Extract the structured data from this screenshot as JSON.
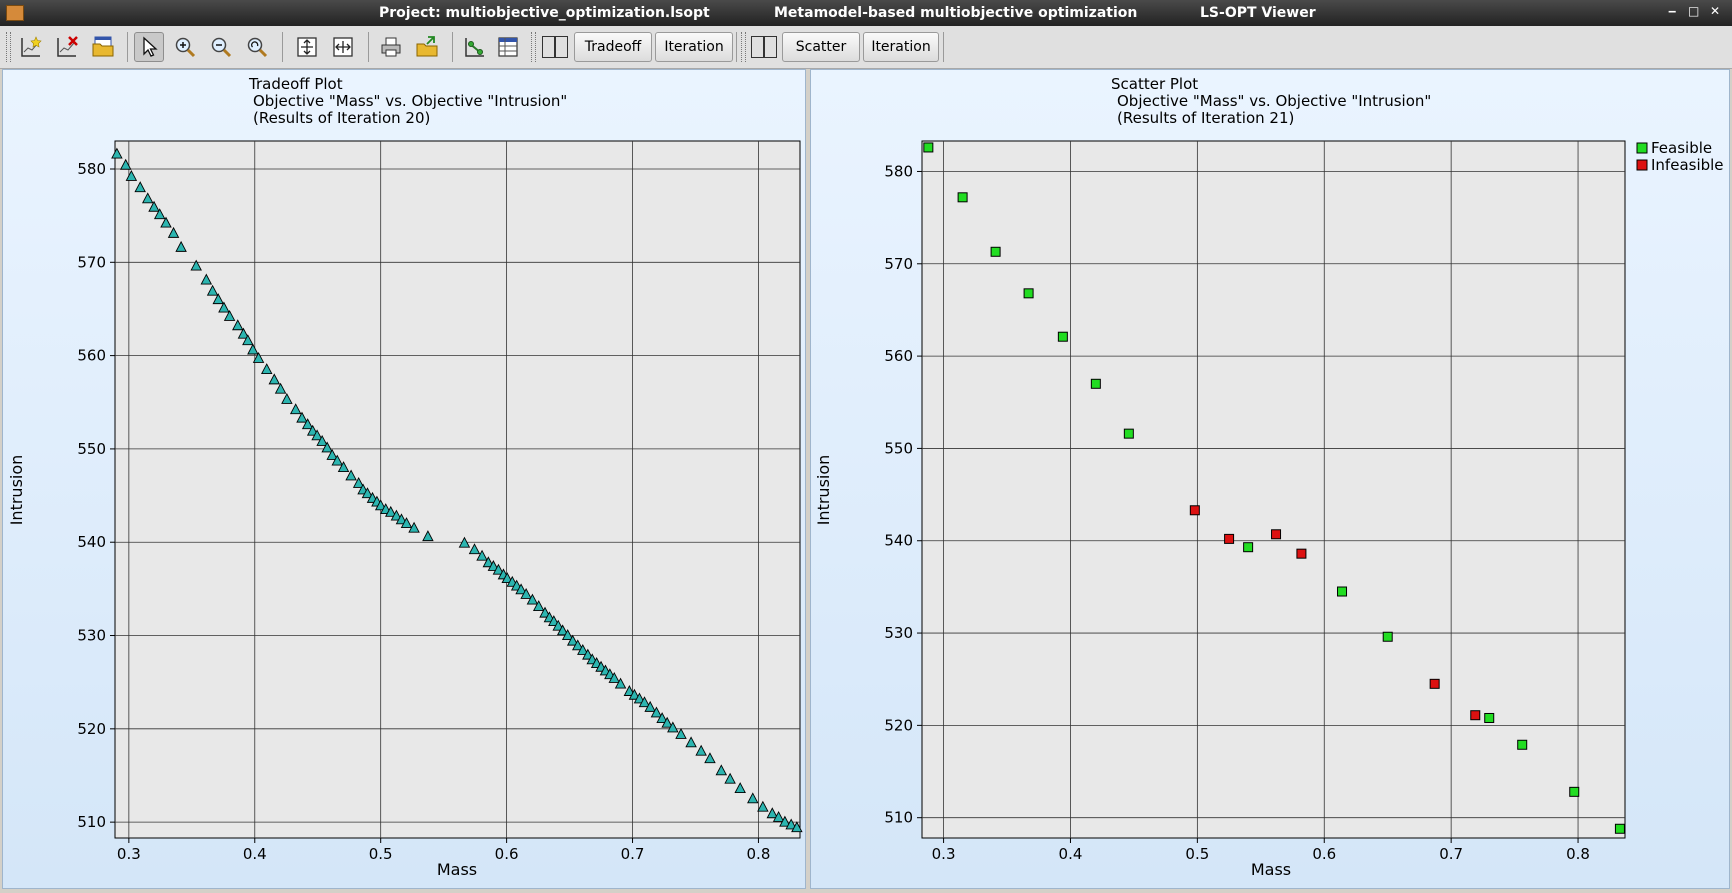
{
  "window": {
    "project_title": "Project: multiobjective_optimization.lsopt",
    "mode_title": "Metamodel-based multiobjective optimization",
    "app_title": "LS-OPT Viewer",
    "controls": {
      "minimize": "‒",
      "maximize": "□",
      "close": "✕"
    }
  },
  "toolbar": {
    "tradeoff_label": "Tradeoff",
    "iteration_label": "Iteration",
    "scatter_label": "Scatter",
    "iteration2_label": "Iteration",
    "icons": [
      "new-plot-icon",
      "delete-plot-icon",
      "open-folder-icon",
      "pointer-icon",
      "zoom-in-icon",
      "zoom-out-icon",
      "zoom-fit-icon",
      "fit-vertical-icon",
      "fit-horizontal-icon",
      "print-icon",
      "export-folder-icon",
      "point-select-icon",
      "table-icon"
    ]
  },
  "colors": {
    "tradeoff_marker": "#2cb5b0",
    "feasible": "#22dd22",
    "infeasible": "#dd1111",
    "plot_bg": "#e8e8e8"
  },
  "tradeoff": {
    "title_lines": [
      "Tradeoff Plot",
      "Objective \"Mass\" vs. Objective \"Intrusion\"",
      "(Results of Iteration 20)"
    ],
    "xlabel": "Mass",
    "ylabel": "Intrusion"
  },
  "scatter": {
    "title_lines": [
      "Scatter Plot",
      "Objective \"Mass\" vs. Objective \"Intrusion\"",
      "(Results of Iteration 21)"
    ],
    "xlabel": "Mass",
    "ylabel": "Intrusion",
    "legend": [
      {
        "name": "Feasible",
        "color": "#22dd22"
      },
      {
        "name": "Infeasible",
        "color": "#dd1111"
      }
    ]
  },
  "chart_data": [
    {
      "type": "scatter",
      "title": "Tradeoff Plot Objective \"Mass\" vs. Objective \"Intrusion\" (Results of Iteration 20)",
      "xlabel": "Mass",
      "ylabel": "Intrusion",
      "xlim": [
        0.289,
        0.833
      ],
      "ylim": [
        508.3,
        583.0
      ],
      "xticks": [
        0.3,
        0.4,
        0.5,
        0.6,
        0.7,
        0.8
      ],
      "yticks": [
        510,
        520,
        530,
        540,
        550,
        560,
        570,
        580
      ],
      "grid": true,
      "series": [
        {
          "marker": "triangle",
          "color": "#2cb5b0",
          "points": [
            [
              0.2905,
              581.6
            ],
            [
              0.2975,
              580.4
            ],
            [
              0.302,
              579.2
            ],
            [
              0.309,
              578
            ],
            [
              0.315,
              576.8
            ],
            [
              0.32,
              575.9
            ],
            [
              0.3245,
              575.1
            ],
            [
              0.3295,
              574.2
            ],
            [
              0.3355,
              573.1
            ],
            [
              0.3415,
              571.6
            ],
            [
              0.3535,
              569.6
            ],
            [
              0.3615,
              568.1
            ],
            [
              0.3665,
              566.9
            ],
            [
              0.371,
              566
            ],
            [
              0.3755,
              565.1
            ],
            [
              0.38,
              564.2
            ],
            [
              0.3865,
              563.2
            ],
            [
              0.391,
              562.3
            ],
            [
              0.3945,
              561.6
            ],
            [
              0.3985,
              560.6
            ],
            [
              0.403,
              559.7
            ],
            [
              0.4095,
              558.5
            ],
            [
              0.4155,
              557.4
            ],
            [
              0.4205,
              556.4
            ],
            [
              0.4255,
              555.3
            ],
            [
              0.4325,
              554.2
            ],
            [
              0.4375,
              553.3
            ],
            [
              0.442,
              552.6
            ],
            [
              0.446,
              551.9
            ],
            [
              0.4495,
              551.4
            ],
            [
              0.4535,
              550.8
            ],
            [
              0.4575,
              550.1
            ],
            [
              0.4615,
              549.3
            ],
            [
              0.4655,
              548.7
            ],
            [
              0.4705,
              548
            ],
            [
              0.4765,
              547.1
            ],
            [
              0.4825,
              546.3
            ],
            [
              0.486,
              545.6
            ],
            [
              0.4895,
              545.2
            ],
            [
              0.4935,
              544.7
            ],
            [
              0.497,
              544.3
            ],
            [
              0.5,
              543.9
            ],
            [
              0.504,
              543.5
            ],
            [
              0.508,
              543.2
            ],
            [
              0.5125,
              542.8
            ],
            [
              0.5165,
              542.4
            ],
            [
              0.5205,
              542
            ],
            [
              0.5265,
              541.5
            ],
            [
              0.5375,
              540.6
            ],
            [
              0.5665,
              539.9
            ],
            [
              0.5745,
              539.2
            ],
            [
              0.5805,
              538.5
            ],
            [
              0.5855,
              537.8
            ],
            [
              0.5895,
              537.4
            ],
            [
              0.5935,
              537
            ],
            [
              0.5975,
              536.5
            ],
            [
              0.6005,
              536.1
            ],
            [
              0.6045,
              535.7
            ],
            [
              0.608,
              535.3
            ],
            [
              0.6115,
              534.9
            ],
            [
              0.6155,
              534.4
            ],
            [
              0.6205,
              533.8
            ],
            [
              0.6255,
              533.1
            ],
            [
              0.6305,
              532.4
            ],
            [
              0.634,
              531.9
            ],
            [
              0.6375,
              531.5
            ],
            [
              0.641,
              531
            ],
            [
              0.6445,
              530.5
            ],
            [
              0.6485,
              530
            ],
            [
              0.6525,
              529.4
            ],
            [
              0.6565,
              528.9
            ],
            [
              0.6605,
              528.4
            ],
            [
              0.6645,
              527.9
            ],
            [
              0.668,
              527.4
            ],
            [
              0.6715,
              527
            ],
            [
              0.675,
              526.6
            ],
            [
              0.6785,
              526.2
            ],
            [
              0.682,
              525.8
            ],
            [
              0.6855,
              525.4
            ],
            [
              0.6905,
              524.8
            ],
            [
              0.6975,
              524
            ],
            [
              0.7015,
              523.6
            ],
            [
              0.7055,
              523.2
            ],
            [
              0.7095,
              522.8
            ],
            [
              0.714,
              522.3
            ],
            [
              0.719,
              521.7
            ],
            [
              0.7235,
              521.1
            ],
            [
              0.7275,
              520.6
            ],
            [
              0.732,
              520.1
            ],
            [
              0.7385,
              519.4
            ],
            [
              0.7465,
              518.5
            ],
            [
              0.7545,
              517.6
            ],
            [
              0.7615,
              516.8
            ],
            [
              0.7705,
              515.5
            ],
            [
              0.7775,
              514.6
            ],
            [
              0.7855,
              513.6
            ],
            [
              0.7955,
              512.5
            ],
            [
              0.8035,
              511.6
            ],
            [
              0.811,
              510.9
            ],
            [
              0.816,
              510.5
            ],
            [
              0.821,
              510
            ],
            [
              0.826,
              509.7
            ],
            [
              0.8305,
              509.4
            ]
          ]
        }
      ]
    },
    {
      "type": "scatter",
      "title": "Scatter Plot Objective \"Mass\" vs. Objective \"Intrusion\" (Results of Iteration 21)",
      "xlabel": "Mass",
      "ylabel": "Intrusion",
      "xlim": [
        0.283,
        0.837
      ],
      "ylim": [
        507.8,
        583.3
      ],
      "xticks": [
        0.3,
        0.4,
        0.5,
        0.6,
        0.7,
        0.8
      ],
      "yticks": [
        510,
        520,
        530,
        540,
        550,
        560,
        570,
        580
      ],
      "grid": true,
      "legend_position": "outside-top-right",
      "series": [
        {
          "name": "Feasible",
          "marker": "square",
          "color": "#22dd22",
          "points": [
            [
              0.288,
              582.6
            ],
            [
              0.315,
              577.2
            ],
            [
              0.341,
              571.3
            ],
            [
              0.367,
              566.8
            ],
            [
              0.394,
              562.1
            ],
            [
              0.42,
              557
            ],
            [
              0.446,
              551.6
            ],
            [
              0.54,
              539.3
            ],
            [
              0.614,
              534.5
            ],
            [
              0.65,
              529.6
            ],
            [
              0.73,
              520.8
            ],
            [
              0.756,
              517.9
            ],
            [
              0.797,
              512.8
            ],
            [
              0.833,
              508.8
            ]
          ]
        },
        {
          "name": "Infeasible",
          "marker": "square",
          "color": "#dd1111",
          "points": [
            [
              0.498,
              543.3
            ],
            [
              0.525,
              540.2
            ],
            [
              0.562,
              540.7
            ],
            [
              0.582,
              538.6
            ],
            [
              0.687,
              524.5
            ],
            [
              0.719,
              521.1
            ]
          ]
        }
      ]
    }
  ]
}
